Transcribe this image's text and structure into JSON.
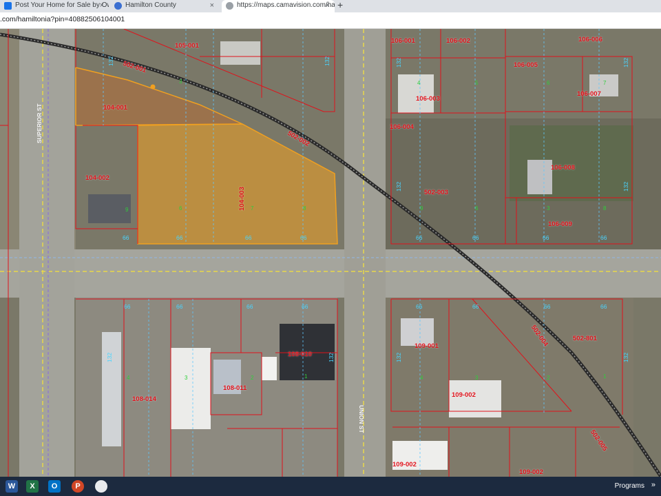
{
  "browser": {
    "tabs": [
      {
        "label": "Post Your Home for Sale by Own",
        "active": false
      },
      {
        "label": "Hamilton County",
        "active": false
      },
      {
        "label": "https://maps.camavision.com/ha",
        "active": true
      }
    ],
    "close_glyph": "×",
    "new_tab_glyph": "+",
    "address": ".com/hamiltonia?pin=40882506104001"
  },
  "map": {
    "parcels": [
      {
        "id": "105-001"
      },
      {
        "id": "502-001"
      },
      {
        "id": "104-001"
      },
      {
        "id": "104-002"
      },
      {
        "id": "104-003"
      },
      {
        "id": "502-002"
      },
      {
        "id": "106-001"
      },
      {
        "id": "106-002"
      },
      {
        "id": "106-006"
      },
      {
        "id": "106-005"
      },
      {
        "id": "106-007"
      },
      {
        "id": "106-003"
      },
      {
        "id": "106-004"
      },
      {
        "id": "106-008"
      },
      {
        "id": "502-003"
      },
      {
        "id": "106-009"
      },
      {
        "id": "108-010"
      },
      {
        "id": "109-001"
      },
      {
        "id": "502-004"
      },
      {
        "id": "502-801"
      },
      {
        "id": "108-014"
      },
      {
        "id": "108-011"
      },
      {
        "id": "109-002"
      },
      {
        "id": "109-002"
      },
      {
        "id": "502-005"
      },
      {
        "id": "109-002"
      }
    ],
    "dims": [
      "132",
      "132",
      "132",
      "132",
      "66",
      "66",
      "66",
      "66",
      "66",
      "66",
      "66",
      "66",
      "66",
      "66",
      "66",
      "66",
      "66",
      "66",
      "66",
      "66",
      "132",
      "132",
      "132",
      "132",
      "132",
      "132"
    ],
    "lots": [
      "3",
      "9",
      "6",
      "7",
      "8",
      "9",
      "6",
      "4",
      "3",
      "2",
      "1",
      "4",
      "3",
      "2",
      "1",
      "3",
      "4",
      "5",
      "6",
      "7",
      "8"
    ],
    "streets": {
      "superior": "SUPERIOR ST",
      "union": "UNION ST"
    },
    "selected_color": "#f0a020",
    "line_color": "#e0121b"
  },
  "taskbar": {
    "apps": [
      "W",
      "X",
      "O",
      "P",
      "browser"
    ],
    "programs_label": "Programs",
    "chevron": "»"
  }
}
